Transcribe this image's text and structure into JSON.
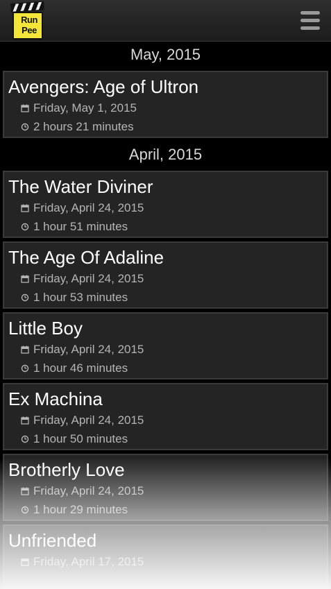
{
  "app": {
    "logo_line1": "Run",
    "logo_line2": "Pee"
  },
  "sections": [
    {
      "month": "May, 2015",
      "movies": [
        {
          "title": "Avengers: Age of Ultron",
          "date": "Friday, May 1, 2015",
          "duration": "2 hours  21 minutes"
        }
      ]
    },
    {
      "month": "April, 2015",
      "movies": [
        {
          "title": "The Water Diviner",
          "date": "Friday, April 24, 2015",
          "duration": "1 hour  51 minutes"
        },
        {
          "title": "The Age Of Adaline",
          "date": "Friday, April 24, 2015",
          "duration": "1 hour  53 minutes"
        },
        {
          "title": "Little Boy",
          "date": "Friday, April 24, 2015",
          "duration": "1 hour  46 minutes"
        },
        {
          "title": "Ex Machina",
          "date": "Friday, April 24, 2015",
          "duration": "1 hour  50 minutes"
        },
        {
          "title": "Brotherly Love",
          "date": "Friday, April 24, 2015",
          "duration": "1 hour  29 minutes"
        },
        {
          "title": "Unfriended",
          "date": "Friday, April 17, 2015",
          "duration": ""
        }
      ]
    }
  ],
  "icons": {
    "menu": "menu-icon",
    "date": "calendar-icon",
    "duration": "clock-icon"
  },
  "colors": {
    "background": "#000000",
    "card": "#242424",
    "card_border": "#3a3a3a",
    "title": "#ffffff",
    "meta": "#b5b5b5",
    "logo_yellow": "#f4e53a"
  }
}
